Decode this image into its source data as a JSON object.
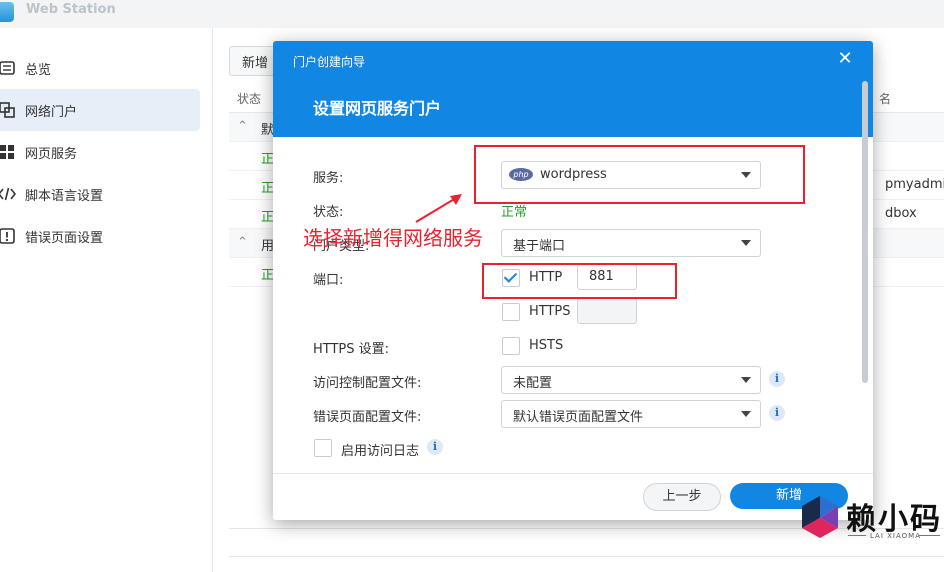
{
  "app": {
    "title": "Web Station"
  },
  "sidebar": {
    "items": [
      {
        "label": "总览",
        "icon": "overview-icon"
      },
      {
        "label": "网络门户",
        "icon": "portal-icon"
      },
      {
        "label": "网页服务",
        "icon": "grid-icon"
      },
      {
        "label": "脚本语言设置",
        "icon": "code-icon"
      },
      {
        "label": "错误页面设置",
        "icon": "error-icon"
      }
    ]
  },
  "main": {
    "add_label": "新增",
    "col_status": "状态",
    "col_name_partial": "名",
    "group1_partial": "默",
    "group2_partial": "用",
    "status_partial": "正",
    "row_names": [
      "pmyadmin",
      "dbox"
    ]
  },
  "dialog": {
    "window_title": "门户创建向导",
    "heading": "设置网页服务门户",
    "service_label": "服务:",
    "service_value": "wordpress",
    "php_badge": "php",
    "status_label": "状态:",
    "status_value": "正常",
    "portal_type_label_partial": "门户类型:",
    "portal_type_value": "基于端口",
    "port_label": "端口:",
    "http_label": "HTTP",
    "http_port": "881",
    "https_label": "HTTPS",
    "https_settings_label": "HTTPS 设置:",
    "hsts_label": "HSTS",
    "access_control_label": "访问控制配置文件:",
    "access_control_value": "未配置",
    "error_page_label": "错误页面配置文件:",
    "error_page_value": "默认错误页面配置文件",
    "access_log_label": "启用访问日志",
    "prev_button": "上一步",
    "add_button": "新增",
    "close_symbol": "✕",
    "info_symbol": "i"
  },
  "annotation": {
    "text": "选择新增得网络服务",
    "color": "#e8232f"
  },
  "watermark": {
    "text": "赖小码",
    "sub": "LAI XIAOMA"
  },
  "colors": {
    "accent": "#1186e3",
    "status_green": "#2a9d2a"
  }
}
